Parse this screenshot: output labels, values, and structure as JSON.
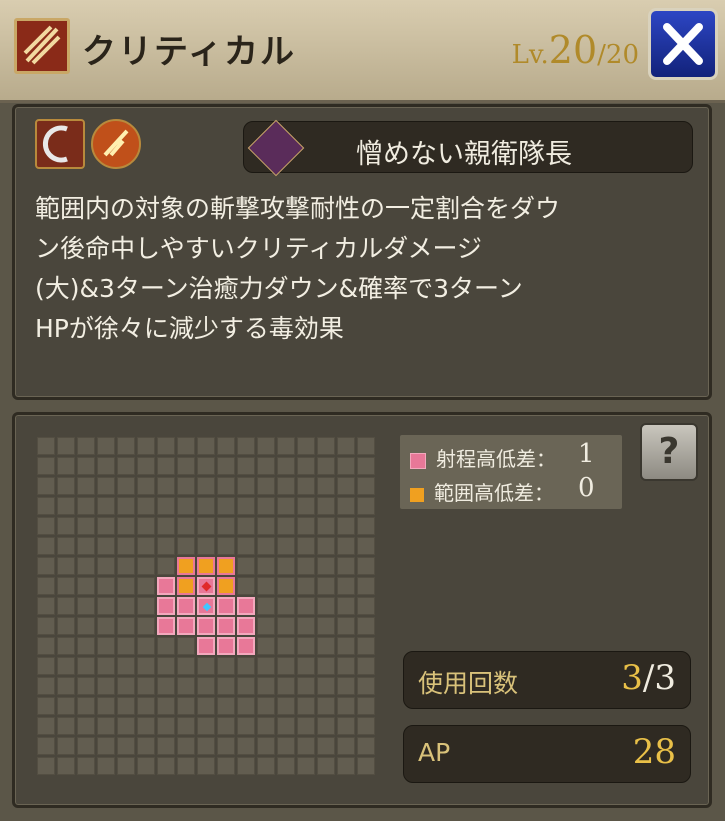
{
  "header": {
    "skill_icon": "slash-claw-icon",
    "title": "クリティカル",
    "level_label": "Lv.",
    "level_current": "20",
    "level_max": "/20",
    "close_icon": "close-x-icon",
    "accent_color": "#1e36b0"
  },
  "ability": {
    "effect_icons": [
      "crescent-slash-icon",
      "flame-orb-icon"
    ],
    "icon": "crossed-blades-icon",
    "name": "憎めない親衛隊長",
    "description_lines": [
      "範囲内の対象の斬撃攻撃耐性の一定割合をダウ",
      "ン後命中しやすいクリティカルダメージ",
      "(大)&3ターン治癒力ダウン&確率で3ターン",
      "HPが徐々に減少する毒効果"
    ]
  },
  "range": {
    "legend": [
      {
        "label": "射程高低差：",
        "value": "1",
        "color": "#e87898"
      },
      {
        "label": "範囲高低差：",
        "value": "0",
        "color": "#f0a020"
      }
    ],
    "help_icon": "question-mark-icon",
    "grid_size": 17,
    "range_cells": [
      [
        7,
        6
      ],
      [
        7,
        9
      ],
      [
        8,
        6
      ],
      [
        8,
        7
      ],
      [
        8,
        9
      ],
      [
        8,
        10
      ],
      [
        9,
        6
      ],
      [
        9,
        7
      ],
      [
        9,
        8
      ],
      [
        9,
        9
      ],
      [
        9,
        10
      ],
      [
        10,
        8
      ],
      [
        10,
        9
      ],
      [
        10,
        10
      ]
    ],
    "area_cells": [
      [
        6,
        7
      ],
      [
        6,
        8
      ],
      [
        6,
        9
      ],
      [
        7,
        7
      ],
      [
        7,
        9
      ]
    ],
    "target_cell": [
      7,
      8
    ],
    "self_cell": [
      8,
      8
    ]
  },
  "stats": {
    "uses_label": "使用回数",
    "uses_current": "3",
    "uses_max": "/3",
    "ap_label": "AP",
    "ap_value": "28"
  }
}
